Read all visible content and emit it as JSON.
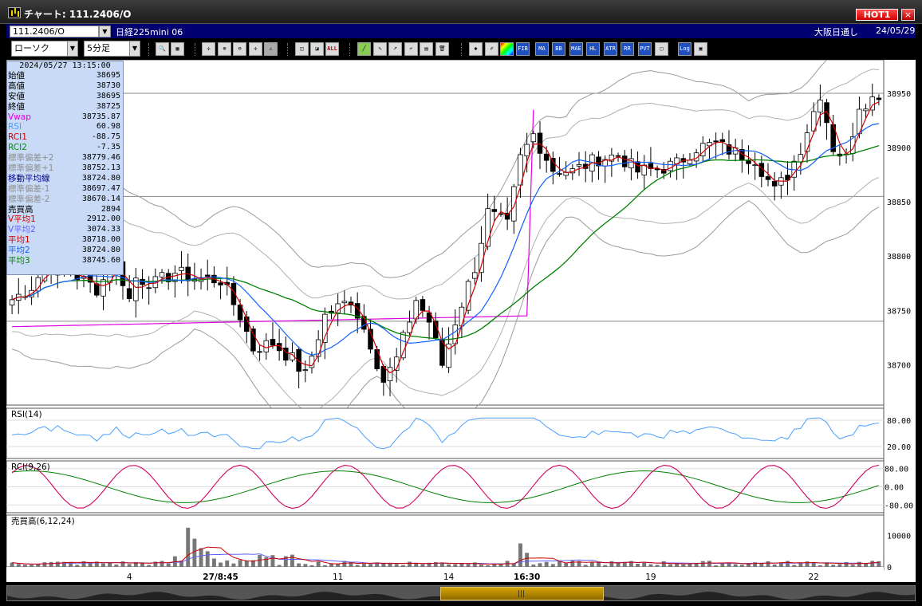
{
  "window": {
    "title": "チャート: 111.2406/O",
    "hot_label": "HOT1",
    "close_label": "×"
  },
  "infobar": {
    "symbol_code": "111.2406/O",
    "symbol_name": "日経225mini 06",
    "market": "大阪日通し",
    "date": "24/05/29"
  },
  "toolbar": {
    "chart_type": "ローソク",
    "timeframe": "5分足",
    "buttons": [
      "zoom-icon",
      "grid-icon",
      "cursor-cross-icon",
      "zoom-in-icon",
      "zoom-out-icon",
      "crosshair-icon",
      "warning-icon",
      "candle-width-icon",
      "candle-shrink-icon",
      "ALL",
      "trendline-icon",
      "draw-icon",
      "select-icon",
      "undo-icon",
      "memo-icon",
      "delete-icon",
      "settings-icon",
      "brush-icon",
      "color-icon",
      "FIB",
      "MA",
      "BB",
      "MAE",
      "HL",
      "ATR",
      "RR",
      "PVT",
      "window-icon",
      "Log",
      "detach-icon"
    ]
  },
  "ohlc_panel": {
    "timestamp": "2024/05/27  13:15:00",
    "rows": [
      {
        "label": "始値",
        "value": "38695",
        "color": "#000000"
      },
      {
        "label": "高値",
        "value": "38730",
        "color": "#000000"
      },
      {
        "label": "安値",
        "value": "38695",
        "color": "#000000"
      },
      {
        "label": "終値",
        "value": "38725",
        "color": "#000000"
      },
      {
        "label": "Vwap",
        "value": "38735.87",
        "color": "#e000e0"
      },
      {
        "label": "RSI",
        "value": "60.98",
        "color": "#4aa0ff"
      },
      {
        "label": "RCI1",
        "value": "-88.75",
        "color": "#d00000"
      },
      {
        "label": "RCI2",
        "value": "-7.35",
        "color": "#009000"
      },
      {
        "label": "標準偏差+2",
        "value": "38779.46",
        "color": "#909090"
      },
      {
        "label": "標準偏差+1",
        "value": "38752.13",
        "color": "#909090"
      },
      {
        "label": "移動平均線",
        "value": "38724.80",
        "color": "#000090"
      },
      {
        "label": "標準偏差-1",
        "value": "38697.47",
        "color": "#909090"
      },
      {
        "label": "標準偏差-2",
        "value": "38670.14",
        "color": "#909090"
      },
      {
        "label": "売買高",
        "value": "2894",
        "color": "#000000"
      },
      {
        "label": "V平均1",
        "value": "2912.00",
        "color": "#d00000"
      },
      {
        "label": "V平均2",
        "value": "3074.33",
        "color": "#6060ff"
      },
      {
        "label": "平均1",
        "value": "38718.00",
        "color": "#d00000"
      },
      {
        "label": "平均2",
        "value": "38724.80",
        "color": "#1060ff"
      },
      {
        "label": "平均3",
        "value": "38745.60",
        "color": "#008000"
      }
    ]
  },
  "chart_data": [
    {
      "type": "candlestick",
      "title": "",
      "y_ticks": [
        38950,
        38900,
        38850,
        38800,
        38750,
        38700
      ],
      "ylim": [
        38665,
        38975
      ],
      "horizontal_lines": [
        38950,
        38855,
        38740
      ],
      "x_ticks": [
        "4",
        "27/8:45",
        "11",
        "14",
        "16:30",
        "19",
        "22"
      ],
      "x_ticks_bold": [
        "27/8:45",
        "16:30"
      ],
      "x_tick_bars": [
        18,
        32,
        50,
        67,
        79,
        98,
        123
      ],
      "total_bars": 134,
      "anchors_close": [
        [
          0,
          38760
        ],
        [
          3,
          38772
        ],
        [
          5,
          38790
        ],
        [
          9,
          38785
        ],
        [
          13,
          38770
        ],
        [
          16,
          38795
        ],
        [
          18,
          38760
        ],
        [
          19,
          38780
        ],
        [
          22,
          38775
        ],
        [
          25,
          38785
        ],
        [
          28,
          38780
        ],
        [
          32,
          38778
        ],
        [
          35,
          38745
        ],
        [
          37,
          38715
        ],
        [
          40,
          38720
        ],
        [
          43,
          38705
        ],
        [
          45,
          38690
        ],
        [
          48,
          38745
        ],
        [
          52,
          38760
        ],
        [
          55,
          38720
        ],
        [
          57,
          38685
        ],
        [
          59,
          38705
        ],
        [
          62,
          38760
        ],
        [
          64,
          38740
        ],
        [
          66,
          38700
        ],
        [
          68,
          38740
        ],
        [
          71,
          38790
        ],
        [
          73,
          38840
        ],
        [
          76,
          38828
        ],
        [
          78,
          38890
        ],
        [
          80,
          38912
        ],
        [
          83,
          38880
        ],
        [
          86,
          38878
        ],
        [
          90,
          38890
        ],
        [
          93,
          38893
        ],
        [
          96,
          38878
        ],
        [
          99,
          38880
        ],
        [
          102,
          38885
        ],
        [
          105,
          38900
        ],
        [
          108,
          38903
        ],
        [
          111,
          38895
        ],
        [
          114,
          38890
        ],
        [
          117,
          38860
        ],
        [
          119,
          38875
        ],
        [
          121,
          38900
        ],
        [
          124,
          38950
        ],
        [
          126,
          38900
        ],
        [
          128,
          38890
        ],
        [
          130,
          38940
        ],
        [
          132,
          38945
        ],
        [
          133,
          38950
        ]
      ],
      "ma_red_period": 3,
      "ma_blue_period": 10,
      "ma_green_period": 30,
      "vwap_anchors": [
        [
          0,
          38735
        ],
        [
          79,
          38745
        ],
        [
          80,
          38935
        ],
        [
          133,
          38935
        ]
      ],
      "bollinger_width": 42,
      "series": [
        {
          "name": "平均1",
          "color": "#d00000"
        },
        {
          "name": "平均2",
          "color": "#1060ff"
        },
        {
          "name": "平均3",
          "color": "#008000"
        },
        {
          "name": "Vwap",
          "color": "#e000e0"
        }
      ]
    },
    {
      "type": "line",
      "title": "RSI(14)",
      "y_ticks": [
        "80.00",
        "20.00"
      ],
      "ylim": [
        0,
        100
      ],
      "series": [
        {
          "name": "RSI",
          "color": "#4aa0ff"
        }
      ]
    },
    {
      "type": "line",
      "title": "RCI(9,26)",
      "y_ticks": [
        "80.00",
        "0.00",
        "-80.00"
      ],
      "ylim": [
        -100,
        100
      ],
      "series": [
        {
          "name": "RCI1",
          "color": "#d00060"
        },
        {
          "name": "RCI2",
          "color": "#008000"
        }
      ]
    },
    {
      "type": "bar",
      "title": "売買高(6,12,24)",
      "y_ticks": [
        "10000",
        "0"
      ],
      "ylim": [
        0,
        15000
      ],
      "spikes": [
        [
          27,
          12500
        ],
        [
          28,
          9000
        ],
        [
          29,
          6000
        ],
        [
          30,
          5000
        ],
        [
          78,
          7500
        ],
        [
          79,
          4500
        ],
        [
          116,
          1800
        ]
      ],
      "series": [
        {
          "name": "V平均1",
          "color": "#d00000"
        },
        {
          "name": "V平均2",
          "color": "#6060ff"
        }
      ]
    }
  ]
}
